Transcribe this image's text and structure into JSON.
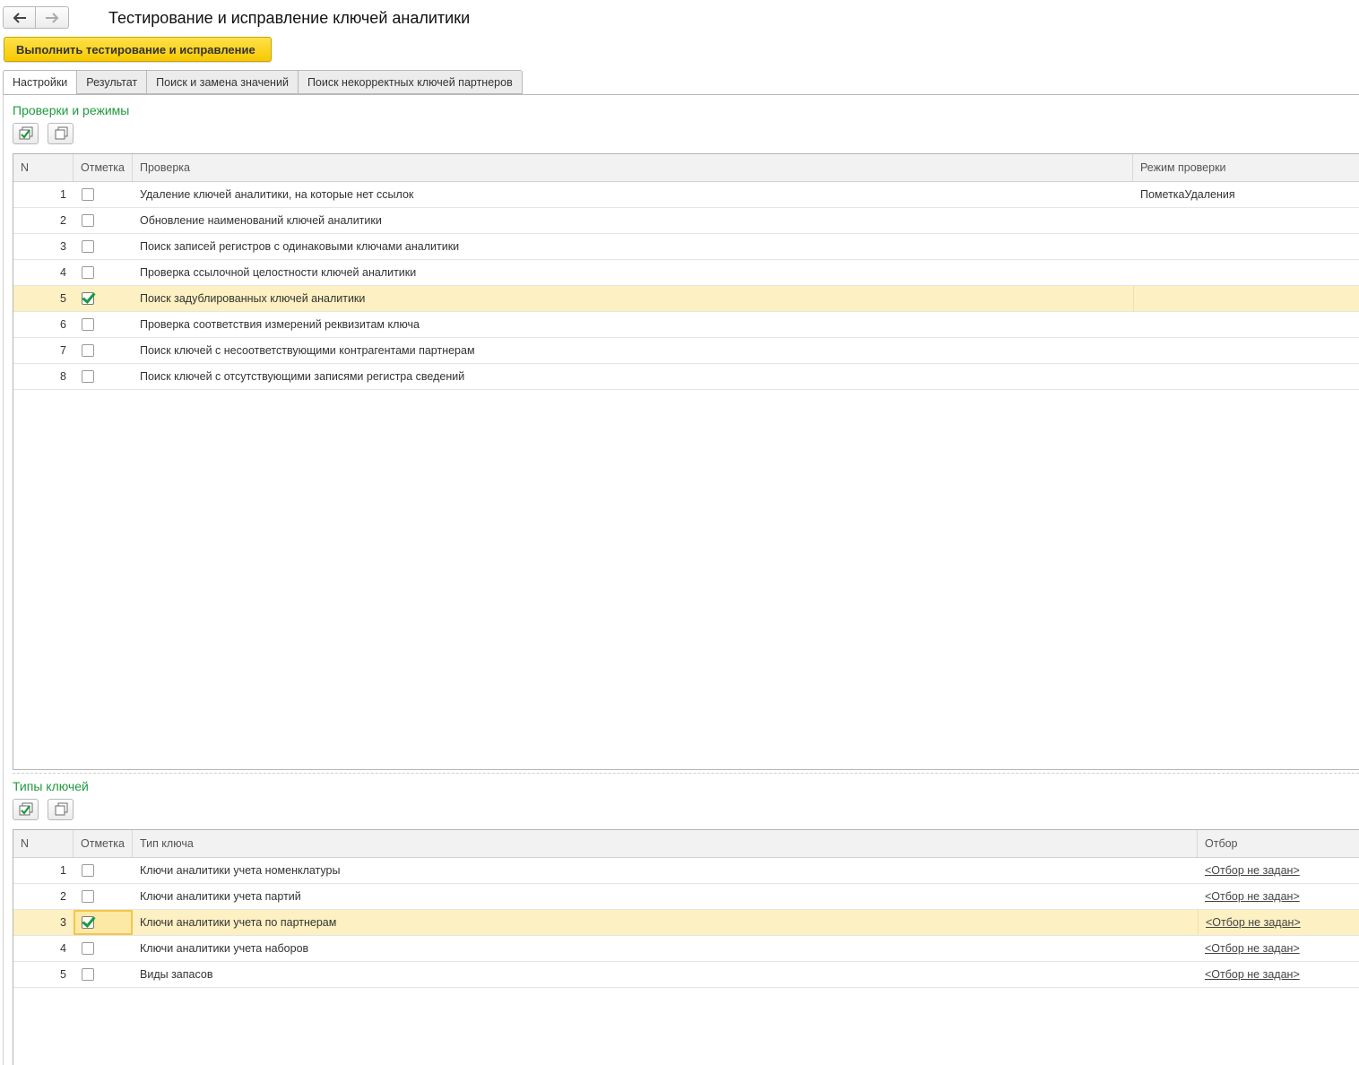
{
  "window": {
    "title": "Тестирование и исправление ключей аналитики",
    "back_icon": "arrow-left-icon",
    "forward_icon": "arrow-right-icon"
  },
  "toolbar": {
    "run_label": "Выполнить тестирование и исправление"
  },
  "tabs": [
    {
      "label": "Настройки",
      "active": true
    },
    {
      "label": "Результат",
      "active": false
    },
    {
      "label": "Поиск и замена значений",
      "active": false
    },
    {
      "label": "Поиск некорректных ключей партнеров",
      "active": false
    }
  ],
  "checks": {
    "section_title": "Проверки и режимы",
    "columns": {
      "n": "N",
      "mark": "Отметка",
      "check": "Проверка",
      "mode": "Режим проверки"
    },
    "rows": [
      {
        "n": "1",
        "checked": false,
        "check": "Удаление ключей аналитики, на которые нет ссылок",
        "mode": "ПометкаУдаления"
      },
      {
        "n": "2",
        "checked": false,
        "check": "Обновление наименований ключей аналитики",
        "mode": ""
      },
      {
        "n": "3",
        "checked": false,
        "check": "Поиск записей регистров с одинаковыми ключами аналитики",
        "mode": ""
      },
      {
        "n": "4",
        "checked": false,
        "check": "Проверка ссылочной целостности ключей аналитики",
        "mode": ""
      },
      {
        "n": "5",
        "checked": true,
        "check": "Поиск задублированных ключей аналитики",
        "mode": ""
      },
      {
        "n": "6",
        "checked": false,
        "check": "Проверка соответствия измерений реквизитам ключа",
        "mode": ""
      },
      {
        "n": "7",
        "checked": false,
        "check": "Поиск ключей с несоответствующими контрагентами партнерам",
        "mode": ""
      },
      {
        "n": "8",
        "checked": false,
        "check": "Поиск ключей с отсутствующими записями регистра сведений",
        "mode": ""
      }
    ]
  },
  "key_types": {
    "section_title": "Типы ключей",
    "columns": {
      "n": "N",
      "mark": "Отметка",
      "type": "Тип ключа",
      "filter": "Отбор"
    },
    "rows": [
      {
        "n": "1",
        "checked": false,
        "type": "Ключи аналитики учета номенклатуры",
        "filter": "<Отбор не задан>"
      },
      {
        "n": "2",
        "checked": false,
        "type": "Ключи аналитики учета партий",
        "filter": "<Отбор не задан>"
      },
      {
        "n": "3",
        "checked": true,
        "type": "Ключи аналитики учета по партнерам",
        "filter": "<Отбор не задан>"
      },
      {
        "n": "4",
        "checked": false,
        "type": "Ключи аналитики учета наборов",
        "filter": "<Отбор не задан>"
      },
      {
        "n": "5",
        "checked": false,
        "type": "Виды запасов",
        "filter": "<Отбор не задан>"
      }
    ]
  },
  "colors": {
    "accent_yellow": "#f6c900",
    "section_green": "#1f9a3f",
    "selected_row": "#fdf0c2"
  }
}
